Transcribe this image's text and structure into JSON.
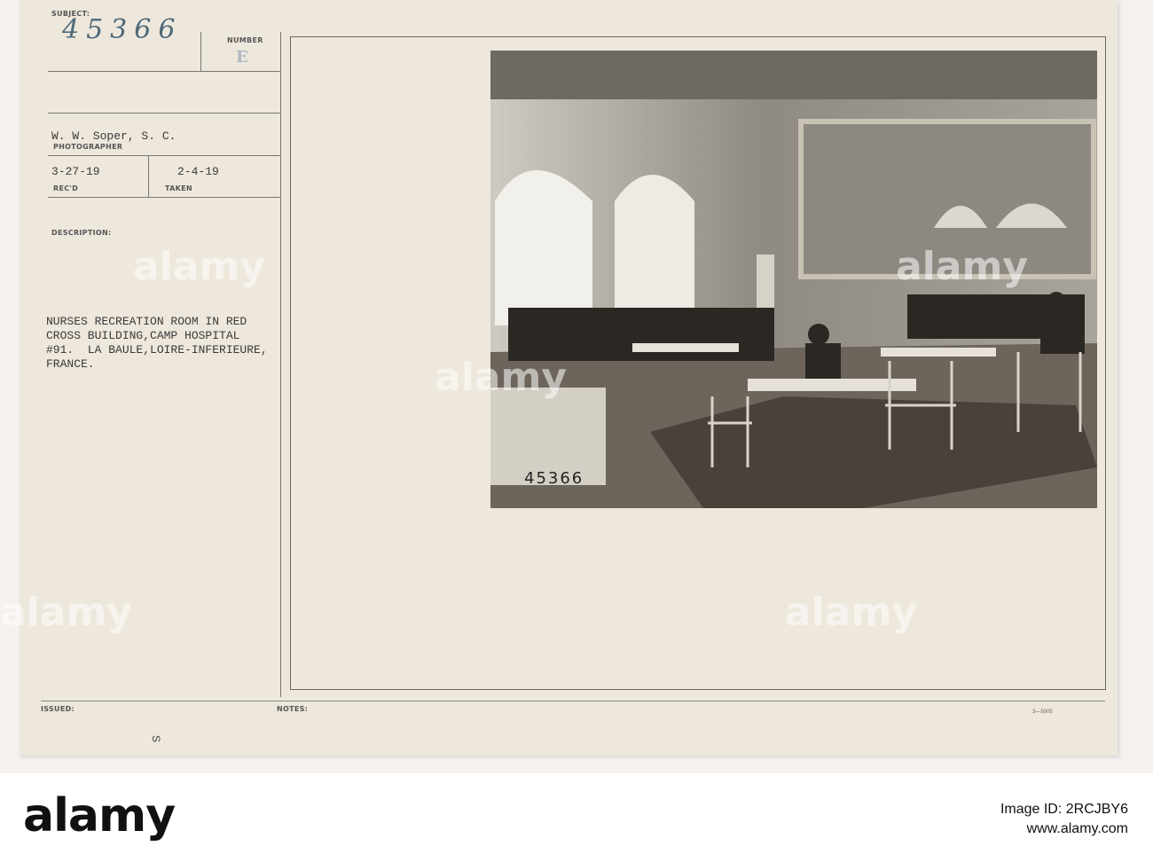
{
  "card": {
    "subject_label": "SUBJECT:",
    "subject_number": "45366",
    "number_label": "NUMBER",
    "number_stamp": "E",
    "photographer": "W. W. Soper, S. C.",
    "photographer_label": "PHOTOGRAPHER",
    "received_date": "3-27-19",
    "received_label": "REC'D",
    "taken_date": "2-4-19",
    "taken_label": "TAKEN",
    "description_label": "DESCRIPTION:",
    "description": "NURSES RECREATION ROOM IN RED\nCROSS BUILDING,CAMP HOSPITAL\n#91.  LA BAULE,LOIRE-INFERIEURE,\nFRANCE.",
    "issued_label": "ISSUED:",
    "notes_label": "NOTES:",
    "form_code": "3—5005",
    "margin_mark": "S"
  },
  "photo": {
    "stamp_number": "45366"
  },
  "watermark": {
    "text": "alamy"
  },
  "footer": {
    "logo": "alamy",
    "image_id": "Image ID: 2RCJBY6",
    "url": "www.alamy.com"
  }
}
